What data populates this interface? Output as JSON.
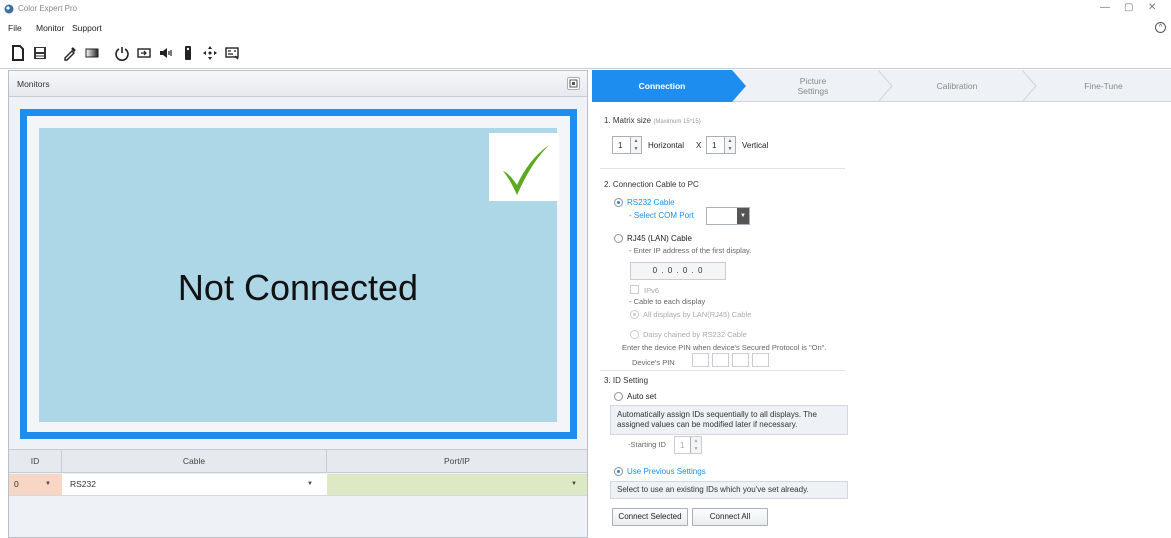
{
  "window": {
    "title": "Color Expert Pro",
    "controls": {
      "minimize": "—",
      "maximize": "▢",
      "close": "✕"
    }
  },
  "menu": {
    "items": [
      "File",
      "Monitor",
      "Support"
    ],
    "collapse": "^"
  },
  "toolbar": {
    "tools": [
      "new-file-icon",
      "save-icon",
      "eyedropper-icon",
      "gradient-icon",
      "power-icon",
      "input-source-icon",
      "volume-icon",
      "remote-icon",
      "move-icon",
      "screen-settings-icon"
    ]
  },
  "monitors": {
    "title": "Monitors",
    "status": "Not Connected",
    "screen_color": "#add6e6",
    "frame_color": "#1d8ef0",
    "check_color": "#5ba821"
  },
  "grid": {
    "headers": [
      "ID",
      "Cable",
      "Port/IP"
    ],
    "rows": [
      {
        "id": "0",
        "id_arrow": "▼",
        "cable": "RS232",
        "cable_arrow": "▼",
        "port": "",
        "port_arrow": "▼"
      }
    ]
  },
  "tabs": [
    {
      "label": "Connection",
      "active": true
    },
    {
      "label": "Picture Settings",
      "line1": "Picture",
      "line2": "Settings",
      "active": false
    },
    {
      "label": "Calibration",
      "active": false
    },
    {
      "label": "Fine-Tune",
      "active": false
    }
  ],
  "connection": {
    "matrix": {
      "title": "1. Matrix size",
      "note": "(Maximum 15*15)",
      "horizontal_value": "1",
      "horizontal_label": "Horizontal",
      "times": "X",
      "vertical_value": "1",
      "vertical_label": "Vertical"
    },
    "cable": {
      "title": "2. Connection Cable to PC",
      "rs232_label": "RS232 Cable",
      "select_com_label": "- Select COM Port",
      "com_value": "",
      "rj45_label": "RJ45 (LAN) Cable",
      "ip_hint": "- Enter IP address of the first display.",
      "ip_value": "0 . 0 . 0 . 0",
      "ipv6_label": "IPv6",
      "each_display_label": "- Cable to each display",
      "all_lan_label": "All displays by LAN(RJ45) Cable",
      "daisy_label": "Daisy chained by RS232 Cable",
      "pin_hint": "Enter the device PIN when device's Secured Protocol is \"On\".",
      "pin_label": "Device's PIN"
    },
    "id_setting": {
      "title": "3. ID Setting",
      "auto_label": "Auto set",
      "auto_desc": "Automatically assign IDs sequentially to all displays. The assigned values can be modified later if necessary.",
      "starting_id_label": "-Starting ID",
      "starting_id_value": "1",
      "previous_label": "Use Previous Settings",
      "previous_desc": "Select to use an existing IDs which you've set already."
    },
    "buttons": {
      "connect_selected": "Connect Selected",
      "connect_all": "Connect All"
    }
  }
}
